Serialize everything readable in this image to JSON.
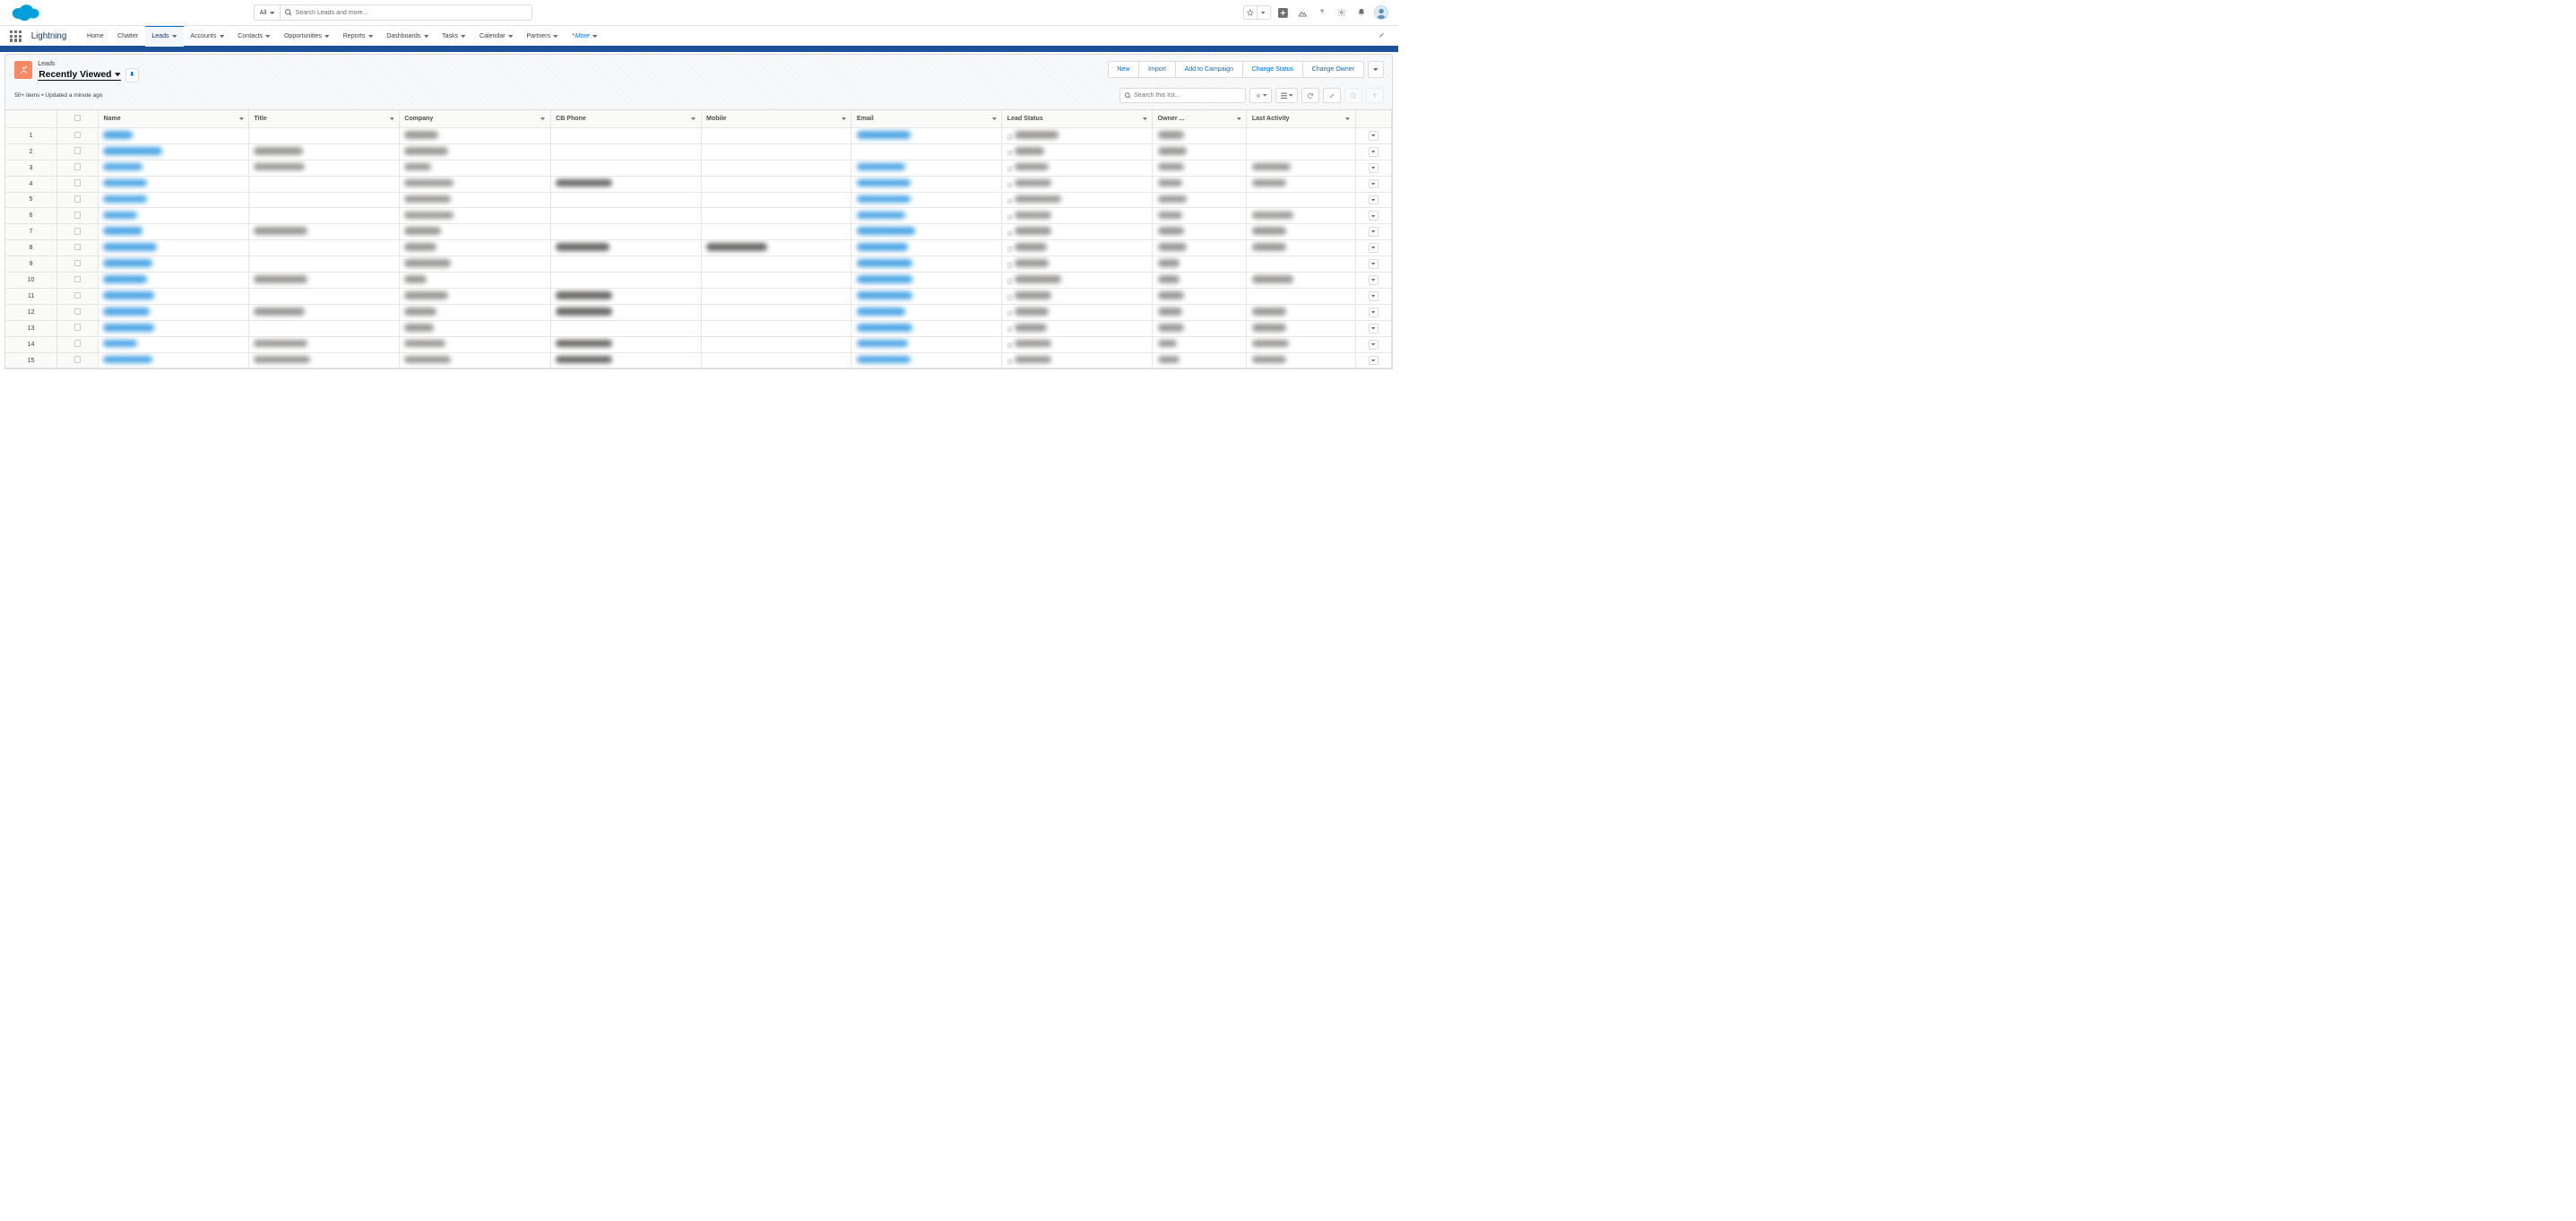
{
  "brand": {
    "app_name": "Lightning"
  },
  "global_search": {
    "scope_label": "All",
    "placeholder": "Search Leads and more..."
  },
  "nav": {
    "items": [
      {
        "label": "Home",
        "has_menu": false
      },
      {
        "label": "Chatter",
        "has_menu": false
      },
      {
        "label": "Leads",
        "has_menu": true,
        "active": true
      },
      {
        "label": "Accounts",
        "has_menu": true
      },
      {
        "label": "Contacts",
        "has_menu": true
      },
      {
        "label": "Opportunities",
        "has_menu": true
      },
      {
        "label": "Reports",
        "has_menu": true
      },
      {
        "label": "Dashboards",
        "has_menu": true
      },
      {
        "label": "Tasks",
        "has_menu": true
      },
      {
        "label": "Calendar",
        "has_menu": true
      },
      {
        "label": "Partners",
        "has_menu": true
      }
    ],
    "more_label": "More"
  },
  "page": {
    "object_label": "Leads",
    "view_name": "Recently Viewed",
    "meta_text": "50+ items • Updated a minute ago",
    "list_search_placeholder": "Search this list...",
    "actions": [
      {
        "label": "New"
      },
      {
        "label": "Import"
      },
      {
        "label": "Add to Campaign"
      },
      {
        "label": "Change Status"
      },
      {
        "label": "Change Owner"
      }
    ]
  },
  "table": {
    "columns": [
      {
        "label": "Name"
      },
      {
        "label": "Title"
      },
      {
        "label": "Company"
      },
      {
        "label": "CB Phone"
      },
      {
        "label": "Mobile"
      },
      {
        "label": "Email"
      },
      {
        "label": "Lead Status"
      },
      {
        "label": "Owner ..."
      },
      {
        "label": "Last Activity"
      }
    ],
    "row_count": 15,
    "note": "Row cell contents are redacted/blurred in the source image; only row numbers 1–15 are legible."
  },
  "colors": {
    "accent": "#0070d2",
    "nav_border": "#1b5297",
    "object_icon_bg": "#f88962",
    "cloud_logo": "#009edb"
  }
}
